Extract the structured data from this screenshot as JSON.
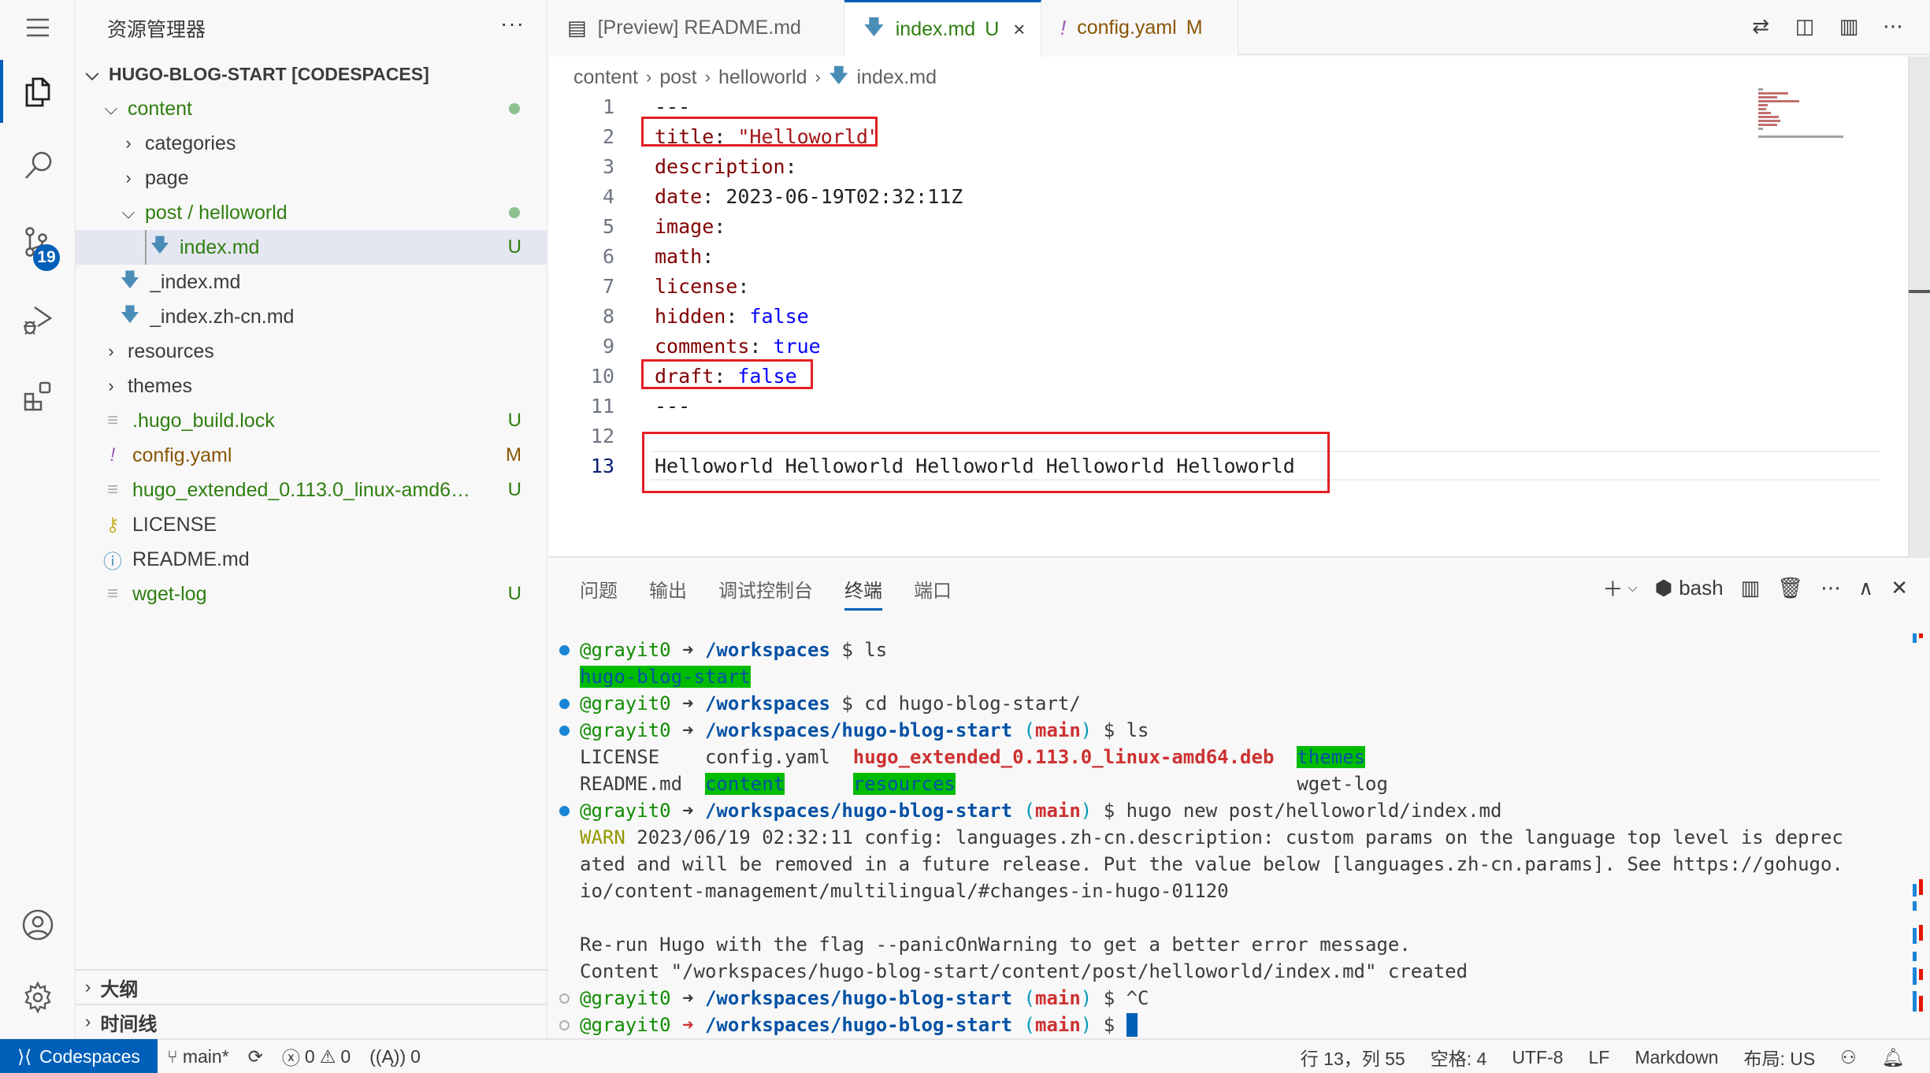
{
  "activity_bar": {
    "items": [
      {
        "name": "explorer",
        "active": true
      },
      {
        "name": "search"
      },
      {
        "name": "source-control",
        "badge": "19"
      },
      {
        "name": "run-debug"
      },
      {
        "name": "extensions"
      }
    ],
    "bottom": [
      {
        "name": "accounts"
      },
      {
        "name": "manage"
      }
    ]
  },
  "sidebar": {
    "title": "资源管理器",
    "more": "···",
    "root": "HUGO-BLOG-START [CODESPACES]",
    "tree": [
      {
        "label": "content",
        "type": "folder-open",
        "status": "dot"
      },
      {
        "label": "categories",
        "type": "folder"
      },
      {
        "label": "page",
        "type": "folder"
      },
      {
        "label": "post / helloworld",
        "type": "folder-open",
        "status": "dot"
      },
      {
        "label": "index.md",
        "type": "md",
        "deco": "U",
        "selected": true
      },
      {
        "label": "_index.md",
        "type": "md"
      },
      {
        "label": "_index.zh-cn.md",
        "type": "md"
      },
      {
        "label": "resources",
        "type": "folder"
      },
      {
        "label": "themes",
        "type": "folder"
      },
      {
        "label": ".hugo_build.lock",
        "type": "text",
        "deco": "U"
      },
      {
        "label": "config.yaml",
        "type": "yaml",
        "deco": "M"
      },
      {
        "label": "hugo_extended_0.113.0_linux-amd64.d...",
        "type": "text",
        "deco": "U"
      },
      {
        "label": "LICENSE",
        "type": "license"
      },
      {
        "label": "README.md",
        "type": "info"
      },
      {
        "label": "wget-log",
        "type": "text",
        "deco": "U"
      }
    ],
    "sections": [
      "大纲",
      "时间线"
    ]
  },
  "tabs": [
    {
      "label": "[Preview] README.md",
      "icon": "preview"
    },
    {
      "label": "index.md",
      "deco": "U",
      "icon": "md",
      "active": true,
      "close": "×"
    },
    {
      "label": "config.yaml",
      "deco": "M",
      "icon": "yaml"
    }
  ],
  "breadcrumb": [
    "content",
    "post",
    "helloworld",
    "index.md"
  ],
  "editor": {
    "lines": [
      {
        "n": "1",
        "tokens": [
          [
            "n",
            "---"
          ]
        ]
      },
      {
        "n": "2",
        "tokens": [
          [
            "k",
            "title"
          ],
          [
            "n",
            ": "
          ],
          [
            "s",
            "\"Helloworld\""
          ]
        ]
      },
      {
        "n": "3",
        "tokens": [
          [
            "k",
            "description"
          ],
          [
            "n",
            ":"
          ]
        ]
      },
      {
        "n": "4",
        "tokens": [
          [
            "k",
            "date"
          ],
          [
            "n",
            ": 2023-06-19T02:32:11Z"
          ]
        ]
      },
      {
        "n": "5",
        "tokens": [
          [
            "k",
            "image"
          ],
          [
            "n",
            ":"
          ]
        ]
      },
      {
        "n": "6",
        "tokens": [
          [
            "k",
            "math"
          ],
          [
            "n",
            ":"
          ]
        ]
      },
      {
        "n": "7",
        "tokens": [
          [
            "k",
            "license"
          ],
          [
            "n",
            ":"
          ]
        ]
      },
      {
        "n": "8",
        "tokens": [
          [
            "k",
            "hidden"
          ],
          [
            "n",
            ": "
          ],
          [
            "b",
            "false"
          ]
        ]
      },
      {
        "n": "9",
        "tokens": [
          [
            "k",
            "comments"
          ],
          [
            "n",
            ": "
          ],
          [
            "b",
            "true"
          ]
        ]
      },
      {
        "n": "10",
        "tokens": [
          [
            "k",
            "draft"
          ],
          [
            "n",
            ": "
          ],
          [
            "b",
            "false"
          ]
        ]
      },
      {
        "n": "11",
        "tokens": [
          [
            "n",
            "---"
          ]
        ]
      },
      {
        "n": "12",
        "tokens": []
      },
      {
        "n": "13",
        "tokens": [
          [
            "n",
            "Helloworld Helloworld Helloworld Helloworld Helloworld"
          ]
        ],
        "current": true
      }
    ]
  },
  "panel": {
    "tabs": [
      "问题",
      "输出",
      "调试控制台",
      "终端",
      "端口"
    ],
    "active_tab": 3,
    "shell": "bash",
    "terminal": [
      {
        "bullet": "ok",
        "prompt": {
          "user": "@grayit0",
          "path": "/workspaces"
        },
        "cmd": " $ ls"
      },
      {
        "segments": [
          [
            "dir",
            "hugo-blog-start"
          ]
        ]
      },
      {
        "bullet": "ok",
        "prompt": {
          "user": "@grayit0",
          "path": "/workspaces"
        },
        "cmd": " $ cd hugo-blog-start/"
      },
      {
        "bullet": "ok",
        "prompt": {
          "user": "@grayit0",
          "path": "/workspaces/hugo-blog-start",
          "branch": "main"
        },
        "cmd": " $ ls"
      },
      {
        "segments": [
          [
            "plain",
            "LICENSE    config.yaml  "
          ],
          [
            "deb",
            "hugo_extended_0.113.0_linux-amd64.deb"
          ],
          [
            "plain",
            "  "
          ],
          [
            "dir",
            "themes"
          ]
        ]
      },
      {
        "segments": [
          [
            "plain",
            "README.md  "
          ],
          [
            "dir",
            "content"
          ],
          [
            "plain",
            "      "
          ],
          [
            "dir",
            "resources"
          ],
          [
            "plain",
            "                              wget-log"
          ]
        ]
      },
      {
        "bullet": "ok",
        "prompt": {
          "user": "@grayit0",
          "path": "/workspaces/hugo-blog-start",
          "branch": "main"
        },
        "cmd": " $ hugo new post/helloworld/index.md"
      },
      {
        "segments": [
          [
            "warn",
            "WARN"
          ],
          [
            "plain",
            " 2023/06/19 02:32:11 config: languages.zh-cn.description: custom params on the language top level is deprec"
          ]
        ]
      },
      {
        "segments": [
          [
            "plain",
            "ated and will be removed in a future release. Put the value below [languages.zh-cn.params]. See https://gohugo."
          ]
        ]
      },
      {
        "segments": [
          [
            "plain",
            "io/content-management/multilingual/#changes-in-hugo-01120"
          ]
        ]
      },
      {
        "segments": [
          [
            "plain",
            ""
          ]
        ]
      },
      {
        "segments": [
          [
            "plain",
            "Re-run Hugo with the flag --panicOnWarning to get a better error message."
          ]
        ]
      },
      {
        "segments": [
          [
            "plain",
            "Content \"/workspaces/hugo-blog-start/content/post/helloworld/index.md\" created"
          ]
        ]
      },
      {
        "bullet": "none",
        "prompt": {
          "user": "@grayit0",
          "path": "/workspaces/hugo-blog-start",
          "branch": "main"
        },
        "cmd": " $ ^C"
      },
      {
        "bullet": "none",
        "prompt": {
          "user": "@grayit0",
          "path": "/workspaces/hugo-blog-start",
          "branch": "main",
          "error": true
        },
        "cmd": " $ ",
        "cursor": true
      }
    ]
  },
  "statusbar": {
    "remote": "Codespaces",
    "branch": "main*",
    "errors": "0",
    "warnings": "0",
    "ports": "0",
    "position": "行 13，列 55",
    "spaces": "空格: 4",
    "encoding": "UTF-8",
    "eol": "LF",
    "language": "Markdown",
    "layout": "布局: US"
  },
  "colors": {
    "accent": "#005fb8",
    "highlight_box": "#e31e24",
    "terminal_dir_bg": "#00bc00",
    "untracked": "#2f7f0f",
    "modified": "#895503"
  }
}
